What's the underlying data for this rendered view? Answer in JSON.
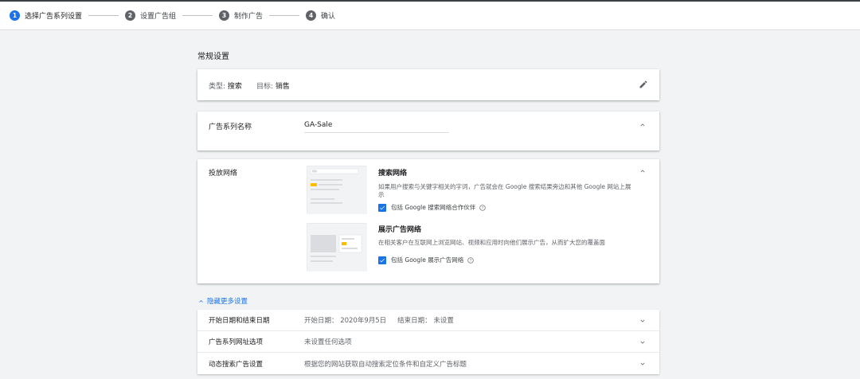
{
  "stepper": {
    "steps": [
      {
        "number": "1",
        "label": "选择广告系列设置"
      },
      {
        "number": "2",
        "label": "设置广告组"
      },
      {
        "number": "3",
        "label": "制作广告"
      },
      {
        "number": "4",
        "label": "确认"
      }
    ]
  },
  "general": {
    "title": "常规设置",
    "type_label": "类型:",
    "type_value": "搜索",
    "goal_label": "目标:",
    "goal_value": "销售"
  },
  "campaign_name": {
    "label": "广告系列名称",
    "value": "GA-Sale"
  },
  "network": {
    "label": "投放网络",
    "search": {
      "title": "搜索网络",
      "desc": "如果用户搜索与关键字相关的字词，广告就会在 Google 搜索结果旁边和其他 Google 网站上展示",
      "checkbox_label": "包括 Google 搜索网络合作伙伴"
    },
    "display": {
      "title": "展示广告网络",
      "desc": "在相关客户在互联网上浏览网站、视频和应用时向他们展示广告，从而扩大您的覆盖面",
      "checkbox_label": "包括 Google 展示广告网络"
    }
  },
  "more_settings": {
    "toggle_label": "隐藏更多设置",
    "rows": [
      {
        "label": "开始日期和结束日期",
        "value": "开始日期：  2020年9月5日",
        "value2": "结束日期：  未设置"
      },
      {
        "label": "广告系列网址选项",
        "value": "未设置任何选项",
        "value2": ""
      },
      {
        "label": "动态搜索广告设置",
        "value": "根据您的网站获取自动搜索定位条件和自定义广告标题",
        "value2": ""
      }
    ]
  },
  "colors": {
    "accent": "#1a73e8",
    "text": "#202124",
    "muted": "#5f6368",
    "background": "#f1f3f4"
  },
  "icons": [
    "edit-icon",
    "chevron-up-icon",
    "chevron-down-icon",
    "check-icon",
    "help-icon"
  ]
}
